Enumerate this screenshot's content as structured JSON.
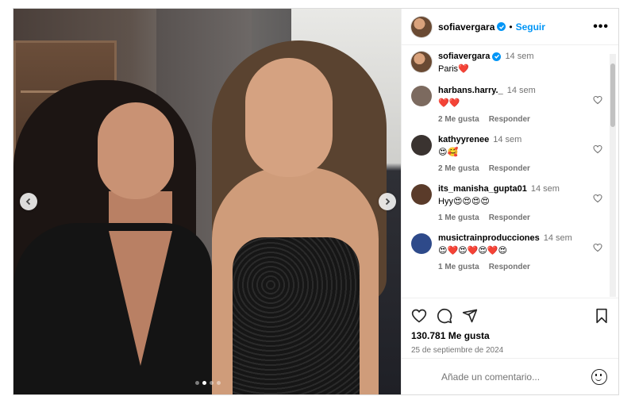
{
  "post": {
    "author": "sofiavergara",
    "follow_label": "Seguir",
    "more_label": "•••",
    "caption_time": "14 sem",
    "caption_text": "Paris❤️",
    "likes_label": "130.781 Me gusta",
    "date_label": "25 de septiembre de 2024",
    "carousel": {
      "slides": 4,
      "active": 1
    }
  },
  "comments": [
    {
      "user": "harbans.harry._",
      "time": "14 sem",
      "text": "❤️❤️",
      "likes": "2 Me gusta",
      "reply": "Responder",
      "avatar": "#7c6a5f"
    },
    {
      "user": "kathyyrenee",
      "time": "14 sem",
      "text": "😍🥰",
      "likes": "2 Me gusta",
      "reply": "Responder",
      "avatar": "#3a3330"
    },
    {
      "user": "its_manisha_gupta01",
      "time": "14 sem",
      "text": "Hyy😍😍😍😍",
      "likes": "1 Me gusta",
      "reply": "Responder",
      "avatar": "#5a3b2a"
    },
    {
      "user": "musictrainproducciones",
      "time": "14 sem",
      "text": "😍❤️😍❤️😍❤️😍",
      "likes": "1 Me gusta",
      "reply": "Responder",
      "avatar": "#2e4a8a"
    }
  ],
  "composer": {
    "placeholder": "Añade un comentario..."
  },
  "colors": {
    "accent": "#0095f6",
    "muted": "#737373",
    "border": "#dbdbdb"
  },
  "icons": [
    "chevron-left-icon",
    "chevron-right-icon",
    "verified-badge-icon",
    "more-icon",
    "heart-icon",
    "comment-icon",
    "share-icon",
    "bookmark-icon",
    "emoji-icon"
  ]
}
